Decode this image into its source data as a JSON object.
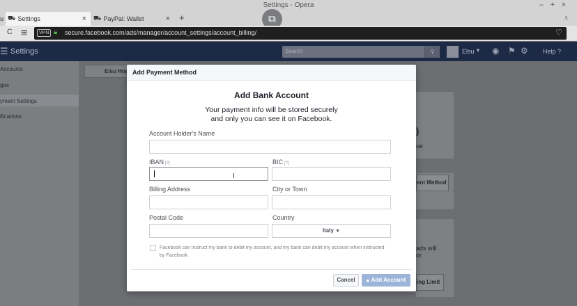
{
  "browser": {
    "window_title": "Settings - Opera",
    "tabs": [
      {
        "label": "u",
        "active": false
      },
      {
        "label": "Settings",
        "active": true
      },
      {
        "label": "PayPal: Wallet",
        "active": false
      }
    ],
    "vpn_label": "VPN",
    "url": "secure.facebook.com/ads/manager/account_settings/account_billing/"
  },
  "fb_header": {
    "title": "Settings",
    "search_placeholder": "Search",
    "user_name": "Elsu",
    "help_label": "Help"
  },
  "sidebar": {
    "items": [
      {
        "label": "Accounts"
      },
      {
        "label": "ges"
      },
      {
        "label": "yment Settings",
        "active": true
      },
      {
        "label": "ifications"
      }
    ]
  },
  "background": {
    "account_button": "Elsu Hop",
    "paren": ")",
    "ue_text": "ue",
    "payment_method_btn": "ent Method",
    "ads_will": "ads will",
    "or_text": "or",
    "limit_btn": "ing Limit"
  },
  "modal": {
    "header": "Add Payment Method",
    "title": "Add Bank Account",
    "subtitle_line1": "Your payment info will be stored securely",
    "subtitle_line2": "and only you can see it on Facebook.",
    "fields": {
      "holder_label": "Account Holder's Name",
      "iban_label": "IBAN",
      "bic_label": "BIC",
      "help_mark": "[?]",
      "billing_label": "Billing Address",
      "city_label": "City or Town",
      "postal_label": "Postal Code",
      "country_label": "Country",
      "country_value": "Italy"
    },
    "consent_text": "Facebook can instruct my bank to debit my account, and my bank can debit my account when instructed by Facebook.",
    "cancel_label": "Cancel",
    "add_label": "Add Account"
  },
  "colors": {
    "fb_navy": "#1d2a45",
    "add_button_disabled": "#9cb4d8"
  }
}
